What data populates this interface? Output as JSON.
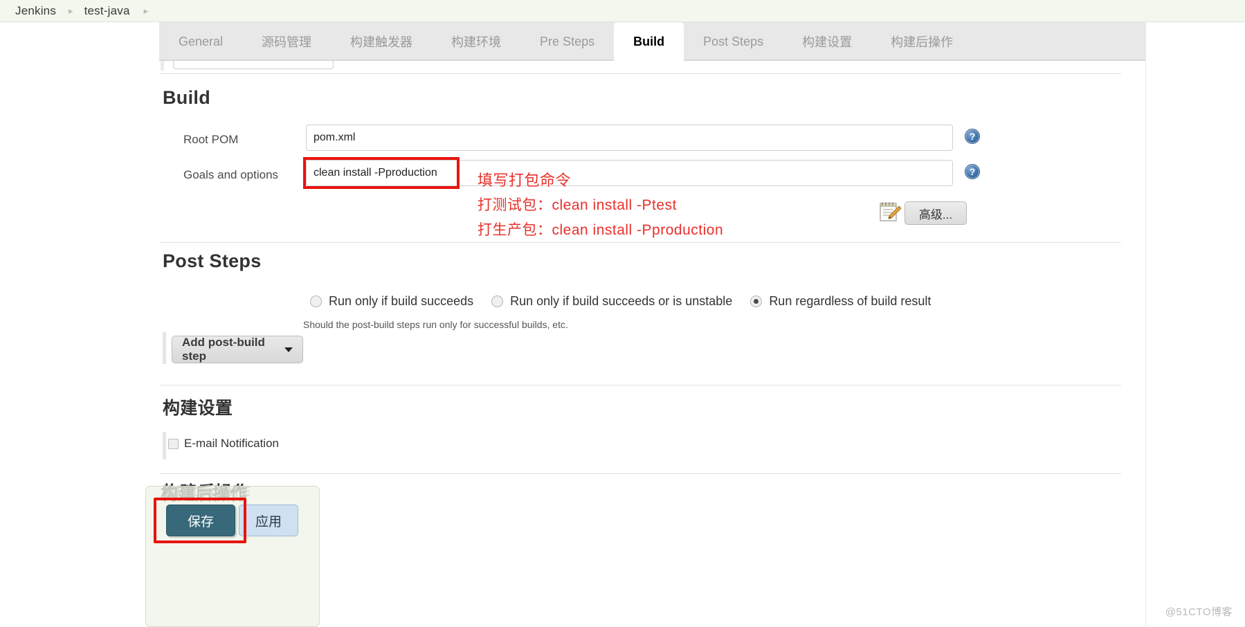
{
  "breadcrumb": {
    "items": [
      "Jenkins",
      "test-java"
    ],
    "separator": "▸"
  },
  "tabs": [
    {
      "label": "General",
      "active": false
    },
    {
      "label": "源码管理",
      "active": false
    },
    {
      "label": "构建触发器",
      "active": false
    },
    {
      "label": "构建环境",
      "active": false
    },
    {
      "label": "Pre Steps",
      "active": false
    },
    {
      "label": "Build",
      "active": true
    },
    {
      "label": "Post Steps",
      "active": false
    },
    {
      "label": "构建设置",
      "active": false
    },
    {
      "label": "构建后操作",
      "active": false
    }
  ],
  "build_section": {
    "title": "Build",
    "root_pom": {
      "label": "Root POM",
      "value": "pom.xml",
      "help": "?"
    },
    "goals": {
      "label": "Goals and options",
      "value": "clean install -Pproduction",
      "help": "?"
    },
    "advanced_button": "高级...",
    "note_icon_name": "notepad-pencil-icon"
  },
  "annotations": {
    "line1": "填写打包命令",
    "line2": "打测试包：clean install -Ptest",
    "line3": "打生产包：clean install -Pproduction",
    "color": "#e8302b",
    "highlight_color": "#e8130f"
  },
  "post_steps": {
    "title": "Post Steps",
    "radios": [
      {
        "label": "Run only if build succeeds",
        "checked": false
      },
      {
        "label": "Run only if build succeeds or is unstable",
        "checked": false
      },
      {
        "label": "Run regardless of build result",
        "checked": true
      }
    ],
    "help_text": "Should the post-build steps run only for successful builds, etc.",
    "add_step_button": "Add post-build step"
  },
  "build_settings": {
    "title": "构建设置",
    "email_notification": {
      "label": "E-mail Notification",
      "checked": false
    }
  },
  "post_build_actions": {
    "title": "构建后操作",
    "ghost_title": "构建后操作"
  },
  "footer_bar": {
    "save_label": "保存",
    "apply_label": "应用"
  },
  "watermark": "@51CTO博客"
}
